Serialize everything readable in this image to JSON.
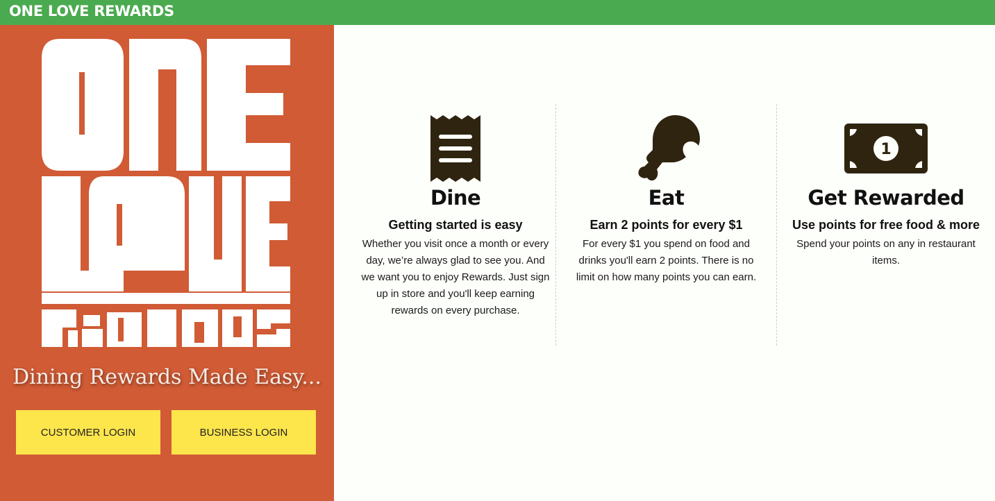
{
  "header": {
    "brand": "ONE LOVE REWARDS"
  },
  "hero": {
    "logo_text": "ONE LOVE REWARDS",
    "tagline": "Dining Rewards Made Easy...",
    "customer_login_label": "CUSTOMER LOGIN",
    "business_login_label": "BUSINESS LOGIN"
  },
  "features": [
    {
      "icon": "receipt-icon",
      "title": "Dine",
      "subtitle": "Getting started is easy",
      "description": "Whether you visit once a month or every day, we’re always glad to see you. And we want you to enjoy Rewards. Just sign up in store and you'll keep earning rewards on every purchase."
    },
    {
      "icon": "drumstick-icon",
      "title": "Eat",
      "subtitle": "Earn 2 points for every $1",
      "description": "For every $1 you spend on food and drinks you'll earn 2 points. There is no limit on how many points you can earn."
    },
    {
      "icon": "money-bill-icon",
      "title": "Get Rewarded",
      "subtitle": "Use points for free food & more",
      "description": "Spend your points on any in restaurant items."
    }
  ],
  "colors": {
    "header_green": "#4aaa4f",
    "panel_orange": "#d05b35",
    "button_yellow": "#fde54c",
    "icon_dark": "#2e2410"
  }
}
